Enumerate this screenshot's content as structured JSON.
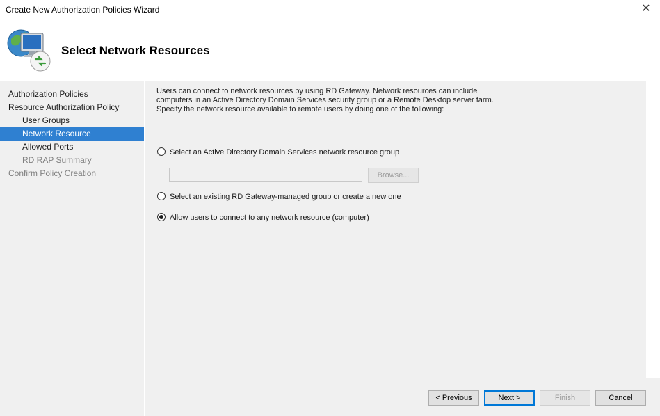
{
  "window": {
    "title": "Create New Authorization Policies Wizard",
    "close_symbol": "✕"
  },
  "header": {
    "heading": "Select Network Resources",
    "icon": "rd-gateway-network-icon"
  },
  "sidebar": {
    "items": [
      {
        "label": "Authorization Policies",
        "level": "top",
        "state": "normal"
      },
      {
        "label": "Resource Authorization Policy",
        "level": "top",
        "state": "normal"
      },
      {
        "label": "User Groups",
        "level": "sub",
        "state": "normal"
      },
      {
        "label": "Network Resource",
        "level": "sub",
        "state": "selected"
      },
      {
        "label": "Allowed Ports",
        "level": "sub",
        "state": "normal"
      },
      {
        "label": "RD RAP Summary",
        "level": "sub",
        "state": "disabled"
      },
      {
        "label": "Confirm Policy Creation",
        "level": "top",
        "state": "disabled"
      }
    ]
  },
  "content": {
    "intro_line1": "Users can connect to network resources by using RD Gateway. Network resources can include",
    "intro_line2": "computers in an Active Directory Domain Services security group or a Remote Desktop server farm.",
    "intro_line3": "Specify the network resource available to remote users by doing one of the following:",
    "options": [
      {
        "label": "Select an Active Directory Domain Services network resource group",
        "checked": false
      },
      {
        "label": "Select an existing RD Gateway-managed group or create a new one",
        "checked": false
      },
      {
        "label": "Allow users to connect to any network resource (computer)",
        "checked": true
      }
    ],
    "group_field_value": "",
    "browse_label": "Browse..."
  },
  "footer": {
    "previous_label": "< Previous",
    "next_label": "Next >",
    "finish_label": "Finish",
    "cancel_label": "Cancel"
  },
  "colors": {
    "selection": "#2f80d1",
    "panel": "#f0f0f0",
    "default_button_border": "#0078d7"
  }
}
